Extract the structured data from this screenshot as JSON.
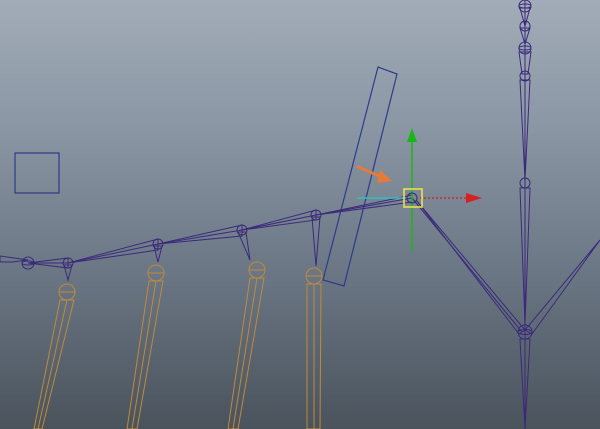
{
  "viewport": {
    "name": "3D rig viewport",
    "background_top": "#a2acb8",
    "background_bottom": "#4a535c"
  },
  "colors": {
    "joint": "#3a2a7a",
    "bone": "#3a2a7a",
    "selected_limb": "#c08a3a",
    "control_curve": "#2e3a8a",
    "selection_highlight": "#f0e64a",
    "axis_x": "#d42020",
    "axis_y": "#18b818",
    "axis_z": "#30c0c0",
    "annotation_arrow": "#e57a3a"
  },
  "icons": {
    "move_manipulator": "move-manipulator-icon",
    "annotation": "arrow-right-icon"
  }
}
